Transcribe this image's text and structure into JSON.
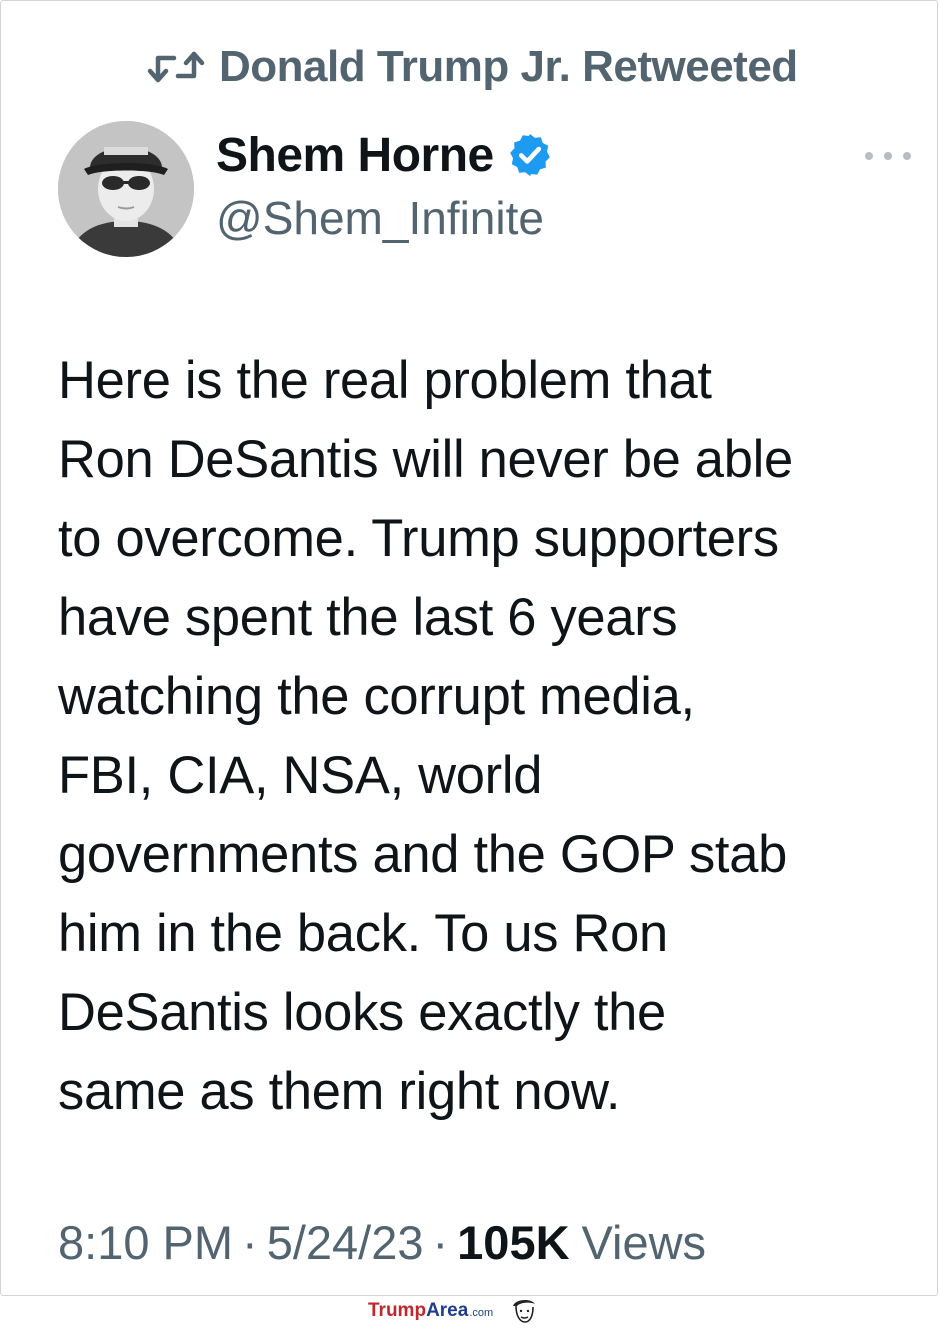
{
  "retweet": {
    "icon": "retweet-icon",
    "text": "Donald Trump Jr. Retweeted"
  },
  "author": {
    "display_name": "Shem Horne",
    "verified_icon": "verified-badge-icon",
    "verified_color": "#1d9bf0",
    "handle": "@Shem_Infinite"
  },
  "more_menu": {
    "icon": "more-horizontal-icon"
  },
  "tweet": {
    "text": "Here is the real problem that\nRon DeSantis will never be able\nto overcome. Trump supporters\nhave spent the last 6 years\nwatching the corrupt media,\nFBI, CIA, NSA, world\ngovernments and the GOP stab\nhim in the back. To us Ron\nDeSantis looks exactly the\nsame as them right now."
  },
  "meta": {
    "time": "8:10 PM",
    "separator": "·",
    "date": "5/24/23",
    "views_count": "105K",
    "views_label": "Views"
  },
  "watermark": {
    "part1": "Trump",
    "part2": "Area",
    "part3": ".com",
    "icon": "trump-caricature-icon"
  },
  "colors": {
    "text_primary": "#0f1419",
    "text_secondary": "#536471",
    "accent_blue": "#1d9bf0",
    "watermark_red": "#c1272d",
    "watermark_blue": "#1f3d8a"
  }
}
